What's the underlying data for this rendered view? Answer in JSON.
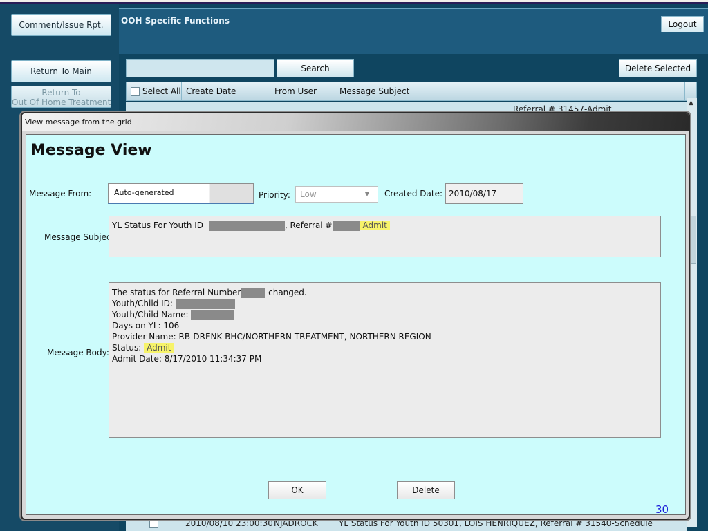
{
  "nav": {
    "comment_btn": "Comment/Issue Rpt.",
    "return_main": "Return To Main",
    "return_ooh_line1": "Return To",
    "return_ooh_line2": "Out Of Home Treatment"
  },
  "header": {
    "title": "OOH Specific Functions",
    "logout": "Logout"
  },
  "toolbar": {
    "search_label": "Search",
    "search_value": "",
    "delete_selected": "Delete Selected"
  },
  "grid": {
    "columns": [
      "Select All",
      "Create Date",
      "From User",
      "Message Subject"
    ],
    "row_top_partial": "Referral # 31457-Admit",
    "row_bottom": {
      "date": "2010/08/10 23:00:30",
      "user": "NJADROCK",
      "subject": "YL Status For Youth ID 50301, LOIS HENRIQUEZ, Referral # 31540-Schedule"
    }
  },
  "dialog": {
    "window_title": "View message from the grid",
    "heading": "Message View",
    "from_label": "Message From:",
    "from_value": "Auto-generated",
    "priority_label": "Priority:",
    "priority_value": "Low",
    "created_label": "Created Date:",
    "created_value": "2010/08/17",
    "subject_label": "Message Subject:",
    "subject_prefix": "YL Status For Youth ID",
    "subject_mid": ", Referral #",
    "subject_status": "Admit",
    "body_label": "Message Body:",
    "body": {
      "l1_a": "The status for Referral Number",
      "l1_b": " changed.",
      "l2": "Youth/Child ID:",
      "l3": "Youth/Child Name:",
      "l4": "Days on YL:  106",
      "l5": "Provider Name:  RB-DRENK BHC/NORTHERN TREATMENT, NORTHERN REGION",
      "l6_label": "Status:",
      "l6_value": "Admit",
      "l7": "Admit Date:  8/17/2010 11:34:37 PM"
    },
    "ok_label": "OK",
    "delete_label": "Delete",
    "page_number": "30"
  }
}
